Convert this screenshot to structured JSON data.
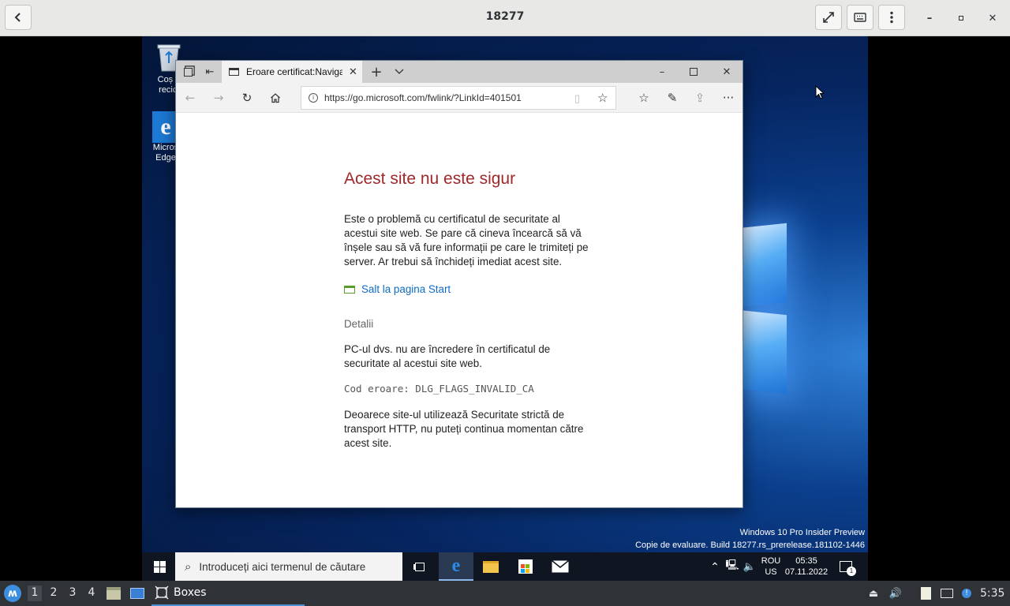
{
  "viewer": {
    "title": "18277"
  },
  "desktop_icons": {
    "recycle": {
      "label_line1": "Coș d",
      "label_line2": "recicl"
    },
    "edge": {
      "label_line1": "Micros",
      "label_line2": "Edge"
    }
  },
  "edge": {
    "tab_title": "Eroare certificat:Navigat",
    "address": "https://go.microsoft.com/fwlink/?LinkId=401501",
    "page": {
      "title": "Acest site nu este sigur",
      "intro": "Este o problemă cu certificatul de securitate al acestui site web. Se pare că cineva încearcă să vă înșele sau să vă fure informații pe care le trimiteți pe server. Ar trebui să închideți imediat acest site.",
      "start_link": "Salt la pagina Start",
      "details_heading": "Detalii",
      "details_text": "PC-ul dvs. nu are încredere în certificatul de securitate al acestui site web.",
      "error_code": "Cod eroare: DLG_FLAGS_INVALID_CA",
      "hsts_text": "Deoarece site-ul utilizează Securitate strictă de transport HTTP, nu puteți continua momentan către acest site."
    }
  },
  "watermark": {
    "line1": "Windows 10 Pro Insider Preview",
    "line2": "Copie de evaluare. Build 18277.rs_prerelease.181102-1446"
  },
  "taskbar": {
    "search_placeholder": "Introduceți aici termenul de căutare",
    "lang_top": "ROU",
    "lang_bottom": "US",
    "time": "05:35",
    "date": "07.11.2022",
    "notifications_count": "1"
  },
  "host_panel": {
    "workspaces": [
      "1",
      "2",
      "3",
      "4"
    ],
    "task_label": "Boxes",
    "clock": "5:35"
  },
  "colors": {
    "error_title": "#a1282a",
    "link": "#0f6bc2",
    "accent": "#0078d7"
  }
}
